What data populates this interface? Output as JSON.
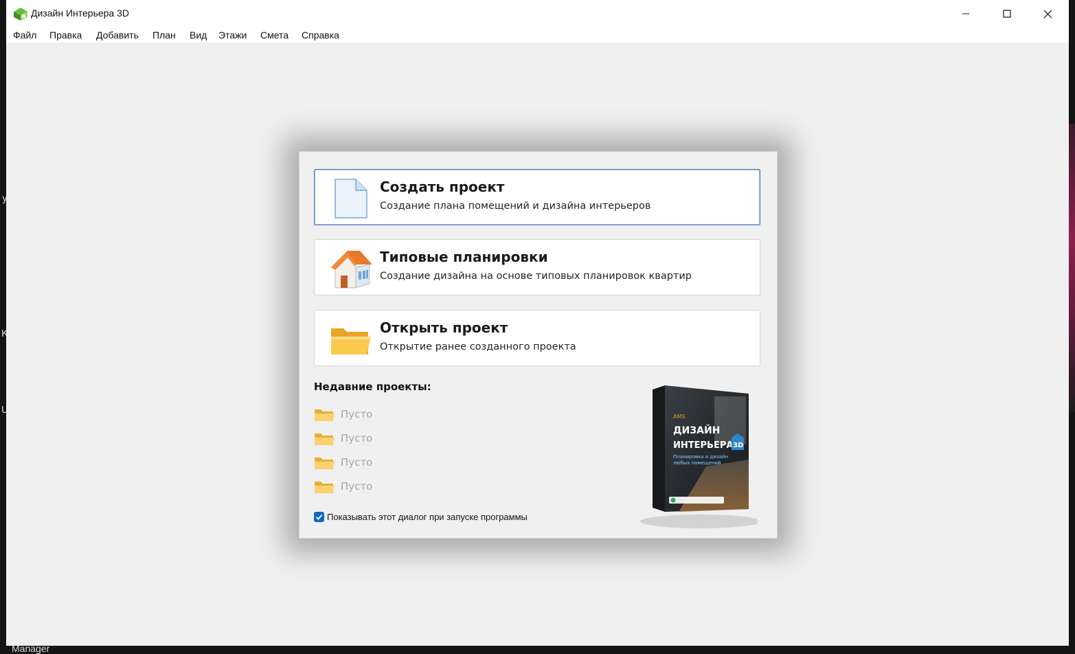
{
  "window": {
    "title": "Дизайн Интерьера 3D",
    "controls": {
      "minimize": "minimize-icon",
      "maximize": "maximize-icon",
      "close": "close-icon"
    }
  },
  "menu": [
    "Файл",
    "Правка",
    "Добавить",
    "План",
    "Вид",
    "Этажи",
    "Смета",
    "Справка"
  ],
  "dialog": {
    "actions": [
      {
        "title": "Создать проект",
        "desc": "Создание плана помещений и дизайна интерьеров",
        "icon": "document-icon"
      },
      {
        "title": "Типовые планировки",
        "desc": "Создание дизайна на основе типовых планировок квартир",
        "icon": "house-icon"
      },
      {
        "title": "Открыть проект",
        "desc": "Открытие ранее созданного проекта",
        "icon": "folder-icon"
      }
    ],
    "recent_heading": "Недавние проекты:",
    "recent_items": [
      "Пусто",
      "Пусто",
      "Пусто",
      "Пусто"
    ],
    "show_on_start": {
      "label": "Показывать этот диалог при запуске программы",
      "checked": true
    },
    "product_box": {
      "brand": "AMS",
      "title_line1": "ДИЗАЙН",
      "title_line2": "ИНТЕРЬЕРА",
      "badge": "3D",
      "subtitle1": "Планировка и дизайн",
      "subtitle2": "любых помещений"
    }
  },
  "background": {
    "left_fragments": [
      "у",
      "К",
      "U"
    ],
    "bottom_text": "Manager"
  },
  "colors": {
    "window_bg": "#f0f0f0",
    "selected_border": "#5a7fb0",
    "checkbox": "#1565c0",
    "folder": "#f5b93a"
  }
}
